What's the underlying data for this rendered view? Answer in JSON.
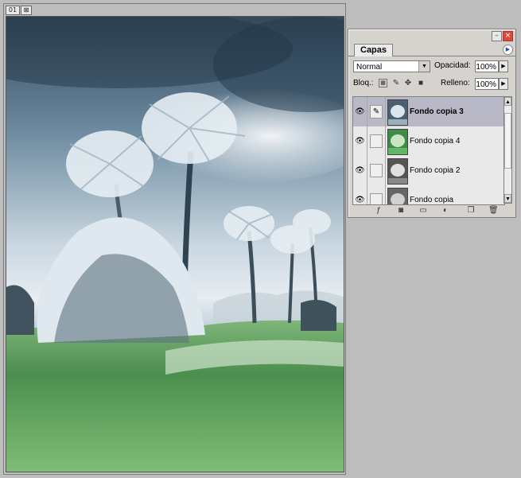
{
  "document": {
    "tab_number": "01",
    "close_glyph": "⊠"
  },
  "layers_palette": {
    "tab_label": "Capas",
    "blend_mode": "Normal",
    "opacity_label": "Opacidad:",
    "opacity_value": "100%",
    "lock_label": "Bloq.:",
    "fill_label": "Relleno:",
    "fill_value": "100%",
    "layers": [
      {
        "name": "Fondo copia 3",
        "selected": true
      },
      {
        "name": "Fondo copia 4",
        "selected": false
      },
      {
        "name": "Fondo copia 2",
        "selected": false
      },
      {
        "name": "Fondo copia",
        "selected": false
      }
    ],
    "bottom_icons": [
      "layer-style-icon",
      "mask-icon",
      "folder-icon",
      "adjustment-layer-icon",
      "new-layer-icon",
      "trash-icon"
    ]
  }
}
